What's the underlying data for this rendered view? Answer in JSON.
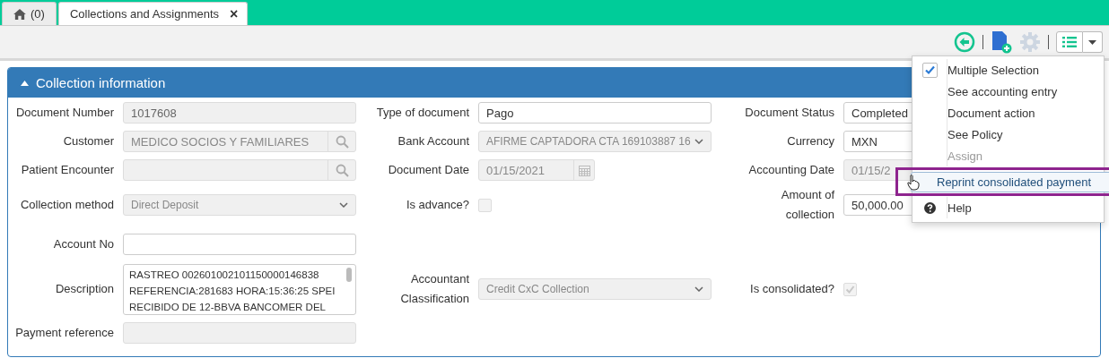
{
  "tabs": [
    {
      "kind": "home",
      "label": "(0)",
      "selected": false
    },
    {
      "kind": "document",
      "label": "Collections and Assignments",
      "close": "×",
      "selected": true
    }
  ],
  "toolbar": {
    "buttons": [
      {
        "kind": "back",
        "disabled": false
      },
      {
        "kind": "separator"
      },
      {
        "kind": "new-document",
        "disabled": false
      },
      {
        "kind": "settings",
        "disabled": true
      },
      {
        "kind": "separator"
      },
      {
        "kind": "list-menu",
        "disabled": false
      }
    ]
  },
  "section": {
    "title": "Collection information",
    "expanded": true,
    "rows": [
      {
        "cells": [
          {
            "label": "Document Number",
            "kind": "text",
            "value": "1017608",
            "disabled": true
          },
          {
            "label": "Type of document",
            "kind": "text",
            "value": "Pago",
            "disabled": false
          },
          {
            "label": "Document Status",
            "kind": "text",
            "value": "Completed",
            "disabled": false
          }
        ]
      },
      {
        "cells": [
          {
            "label": "Customer",
            "kind": "lookup",
            "value": "MEDICO SOCIOS Y FAMILIARES",
            "disabled": true
          },
          {
            "label": "Bank Account",
            "kind": "select",
            "value": "AFIRME CAPTADORA CTA 169103887 16",
            "disabled": true
          },
          {
            "label": "Currency",
            "kind": "text",
            "value": "MXN",
            "disabled": false
          }
        ]
      },
      {
        "cells": [
          {
            "label": "Patient Encounter",
            "kind": "lookup",
            "disabled": true
          },
          {
            "label": "Document Date",
            "kind": "date",
            "value": "01/15/2021",
            "disabled": true
          },
          {
            "label": "Accounting Date",
            "kind": "text",
            "value": "01/15/2",
            "disabled": true
          }
        ]
      },
      {
        "cells": [
          {
            "label": "Collection method",
            "kind": "select",
            "value": "Direct Deposit",
            "disabled": true
          },
          {
            "label": "Is advance?",
            "kind": "checkbox",
            "checked": false,
            "disabled": true
          },
          {
            "label": "Amount of collection",
            "kind": "amount",
            "value": "50,000.00",
            "disabled": false
          }
        ]
      },
      {
        "cells": [
          {
            "label": "Account No",
            "kind": "text",
            "disabled": false
          }
        ]
      },
      {
        "cells": [
          {
            "label": "Description",
            "kind": "textarea",
            "lines": [
              "RASTREO 002601002101150000146838",
              "REFERENCIA:281683 HORA:15:36:25 SPEI",
              "RECIBIDO DE 12-BBVA BANCOMER DEL"
            ],
            "disabled": false
          },
          {
            "label": "Accountant Classification",
            "kind": "select",
            "value": "Credit CxC Collection",
            "disabled": true
          },
          {
            "label": "Is consolidated?",
            "kind": "checkbox",
            "checked": true,
            "disabled": true
          }
        ]
      },
      {
        "cells": [
          {
            "label": "Payment reference",
            "kind": "text",
            "disabled": true
          }
        ]
      }
    ]
  },
  "menu": {
    "items": [
      {
        "kind": "checkbox",
        "label": "Multiple Selection",
        "checked": true,
        "disabled": false,
        "highlighted": false
      },
      {
        "kind": "plain",
        "label": "See accounting entry",
        "disabled": false,
        "highlighted": false
      },
      {
        "kind": "plain",
        "label": "Document action",
        "disabled": false,
        "highlighted": false
      },
      {
        "kind": "plain",
        "label": "See Policy",
        "disabled": false,
        "highlighted": false
      },
      {
        "kind": "plain",
        "label": "Assign",
        "disabled": true,
        "highlighted": false
      },
      {
        "kind": "plain",
        "label": "Reprint consolidated payment",
        "disabled": false,
        "highlighted": true
      },
      {
        "kind": "help",
        "label": "Help",
        "disabled": false,
        "highlighted": false
      }
    ]
  }
}
